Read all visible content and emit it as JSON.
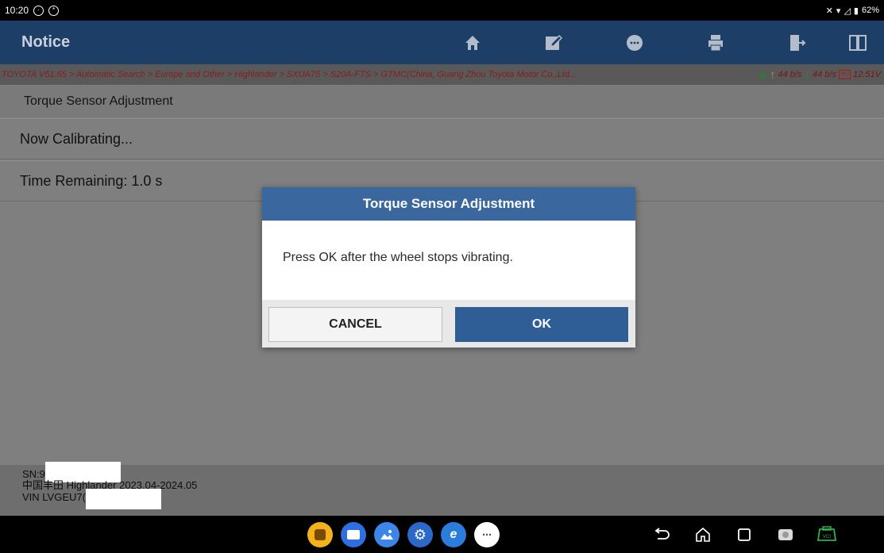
{
  "status_bar": {
    "time": "10:20",
    "battery": "62%"
  },
  "app_bar": {
    "title": "Notice",
    "tools": [
      {
        "icon": "home-icon",
        "glyph": "⌂"
      },
      {
        "icon": "edit-icon",
        "glyph": "✎"
      },
      {
        "icon": "chat-icon",
        "glyph": "●"
      },
      {
        "icon": "print-icon",
        "glyph": "⎙"
      },
      {
        "icon": "exit-icon",
        "glyph": "⇥"
      },
      {
        "icon": "split-view-icon",
        "glyph": "▯▯"
      }
    ]
  },
  "breadcrumb": {
    "path": "TOYOTA V51.65 > Automatic Search > Europe and Other > Highlander > SXUA75 > S20A-FTS > GTMC(China, Guang Zhou Toyota Motor Co.,Ltd...",
    "upload_rate": "44 b/s",
    "download_rate": "44 b/s",
    "voltage": "12.51V"
  },
  "list": {
    "header": "Torque Sensor Adjustment",
    "rows": [
      "Now Calibrating...",
      "Time Remaining: 1.0 s"
    ]
  },
  "footer": {
    "sn_label": "SN:9",
    "vehicle": "中国丰田 Highlander 2023.04-2024.05",
    "vin_label": "VIN LVGEU7("
  },
  "dialog": {
    "title": "Torque Sensor Adjustment",
    "message": "Press OK after the wheel stops vibrating.",
    "cancel_label": "CANCEL",
    "ok_label": "OK"
  },
  "colors": {
    "app_bar": "#1d3e66",
    "dialog_title": "#3a679e",
    "ok_button": "#2f5e97",
    "breadcrumb_text": "#8a1c1c"
  }
}
